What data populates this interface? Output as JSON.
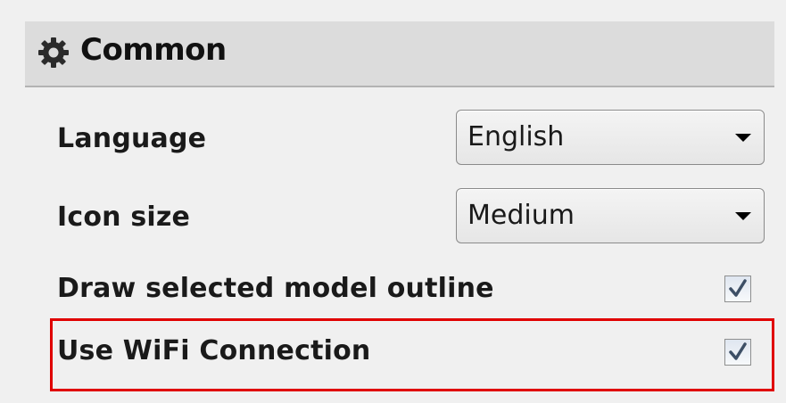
{
  "section": {
    "title": "Common",
    "icon": "gear-icon"
  },
  "settings": {
    "language": {
      "label": "Language",
      "value": "English"
    },
    "icon_size": {
      "label": "Icon size",
      "value": "Medium"
    },
    "draw_outline": {
      "label": "Draw selected model outline",
      "checked": true
    },
    "use_wifi": {
      "label": "Use WiFi Connection",
      "checked": true
    }
  },
  "highlight_color": "#e00000"
}
